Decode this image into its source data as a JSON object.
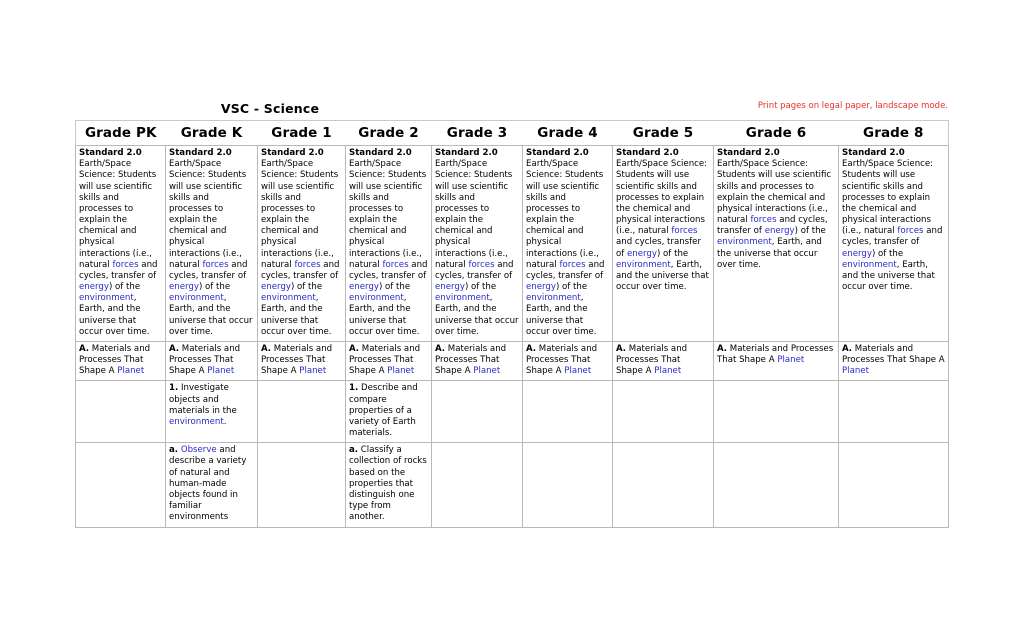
{
  "document": {
    "title": "VSC - Science",
    "print_note": "Print pages on legal paper, landscape mode."
  },
  "table": {
    "columns": [
      "Grade PK",
      "Grade K",
      "Grade 1",
      "Grade 2",
      "Grade 3",
      "Grade 4",
      "Grade 5",
      "Grade 6",
      "Grade 8"
    ],
    "rows": [
      {
        "row_type": "standard",
        "cells": [
          {
            "label": "Standard 2.0",
            "text_before_forces": "Earth/Space Science: Students will use scientific skills and processes to explain the chemical and physical interactions (i.e., natural ",
            "link_forces": "forces",
            "text_mid": " and cycles, transfer of ",
            "link_energy": "energy",
            "text_after_energy": ") of the ",
            "link_environment": "environment",
            "text_end": ", Earth, and the universe that occur over time."
          },
          {
            "label": "Standard 2.0",
            "text_before_forces": "Earth/Space Science: Students will use scientific skills and processes to explain the chemical and physical interactions (i.e., natural ",
            "link_forces": "forces",
            "text_mid": " and cycles, transfer of ",
            "link_energy": "energy",
            "text_after_energy": ") of the ",
            "link_environment": "environment",
            "text_end": ", Earth, and the universe that occur over time."
          },
          {
            "label": "Standard 2.0",
            "text_before_forces": "Earth/Space Science: Students will use scientific skills and processes to explain the chemical and physical interactions (i.e., natural ",
            "link_forces": "forces",
            "text_mid": " and cycles, transfer of ",
            "link_energy": "energy",
            "text_after_energy": ") of the ",
            "link_environment": "environment",
            "text_end": ", Earth, and the universe that occur over time."
          },
          {
            "label": "Standard 2.0",
            "text_before_forces": "Earth/Space Science: Students will use scientific skills and processes to explain the chemical and physical interactions (i.e., natural ",
            "link_forces": "forces",
            "text_mid": " and cycles, transfer of ",
            "link_energy": "energy",
            "text_after_energy": ") of the ",
            "link_environment": "environment",
            "text_end": ", Earth, and the universe that occur over time."
          },
          {
            "label": "Standard 2.0",
            "text_before_forces": "Earth/Space Science: Students will use scientific skills and processes to explain the chemical and physical interactions (i.e., natural ",
            "link_forces": "forces",
            "text_mid": " and cycles, transfer of ",
            "link_energy": "energy",
            "text_after_energy": ") of the ",
            "link_environment": "environment",
            "text_end": ", Earth, and the universe that occur over time."
          },
          {
            "label": "Standard 2.0",
            "text_before_forces": "Earth/Space Science: Students will use scientific skills and processes to explain the chemical and physical interactions (i.e., natural ",
            "link_forces": "forces",
            "text_mid": " and cycles, transfer of ",
            "link_energy": "energy",
            "text_after_energy": ") of the ",
            "link_environment": "environment",
            "text_end": ", Earth, and the universe that occur over time."
          },
          {
            "label": "Standard 2.0",
            "text_before_forces": "Earth/Space Science: Students will use scientific skills and processes to explain the chemical and physical interactions (i.e., natural ",
            "link_forces": "forces",
            "text_mid": " and cycles, transfer of ",
            "link_energy": "energy",
            "text_after_energy": ") of the ",
            "link_environment": "environment",
            "text_end": ", Earth, and the universe that occur over time."
          },
          {
            "label": "Standard 2.0",
            "text_before_forces": "Earth/Space Science: Students will use scientific skills and processes to explain the chemical and physical interactions (i.e., natural ",
            "link_forces": "forces",
            "text_mid": " and cycles, transfer of ",
            "link_energy": "energy",
            "text_after_energy": ") of the ",
            "link_environment": "environment",
            "text_end": ", Earth, and the universe that occur over time."
          },
          {
            "label": "Standard 2.0",
            "text_before_forces": "Earth/Space Science: Students will use scientific skills and processes to explain the chemical and physical interactions (i.e., natural ",
            "link_forces": "forces",
            "text_mid": " and cycles, transfer of ",
            "link_energy": "energy",
            "text_after_energy": ") of the ",
            "link_environment": "environment",
            "text_end": ", Earth, and the universe that occur over time."
          }
        ]
      },
      {
        "row_type": "topic",
        "cells": [
          {
            "label": "A.",
            "text": " Materials and Processes That Shape A ",
            "link": "Planet",
            "tail": ""
          },
          {
            "label": "A.",
            "text": " Materials and Processes That Shape A ",
            "link": "Planet",
            "tail": ""
          },
          {
            "label": "A.",
            "text": " Materials and Processes That Shape A ",
            "link": "Planet",
            "tail": ""
          },
          {
            "label": "A.",
            "text": " Materials and Processes That Shape A ",
            "link": "Planet",
            "tail": ""
          },
          {
            "label": "A.",
            "text": " Materials and Processes That Shape A ",
            "link": "Planet",
            "tail": ""
          },
          {
            "label": "A.",
            "text": " Materials and Processes That Shape A ",
            "link": "Planet",
            "tail": ""
          },
          {
            "label": "A.",
            "text": " Materials and Processes That Shape A ",
            "link": "Planet",
            "tail": ""
          },
          {
            "label": "A.",
            "text": " Materials and Processes That Shape A ",
            "link": "Planet",
            "tail": ""
          },
          {
            "label": "A.",
            "text": " Materials and Processes That Shape A ",
            "link": "Planet",
            "tail": ""
          }
        ]
      },
      {
        "row_type": "indicator",
        "cells": [
          {
            "empty": true
          },
          {
            "label": "1.",
            "text": " Investigate objects and materials in the ",
            "link": "environment",
            "tail": "."
          },
          {
            "empty": true
          },
          {
            "label": "1.",
            "text": " Describe and compare properties of a variety of Earth materials.",
            "link": "",
            "tail": ""
          },
          {
            "empty": true
          },
          {
            "empty": true
          },
          {
            "empty": true
          },
          {
            "empty": true
          },
          {
            "empty": true
          }
        ]
      },
      {
        "row_type": "objective",
        "cells": [
          {
            "empty": true
          },
          {
            "label": "a.",
            "text": " ",
            "link": "Observe",
            "tail": " and describe a variety of natural and human-made objects found in familiar environments"
          },
          {
            "empty": true
          },
          {
            "label": "a.",
            "text": " Classify a collection of rocks based on the properties that distinguish one type from another.",
            "link": "",
            "tail": ""
          },
          {
            "empty": true
          },
          {
            "empty": true
          },
          {
            "empty": true
          },
          {
            "empty": true
          },
          {
            "empty": true
          }
        ]
      }
    ]
  },
  "colors": {
    "link": "#2b2bc8",
    "note": "#e8302a",
    "border": "#b9b9b9",
    "text": "#000000"
  }
}
